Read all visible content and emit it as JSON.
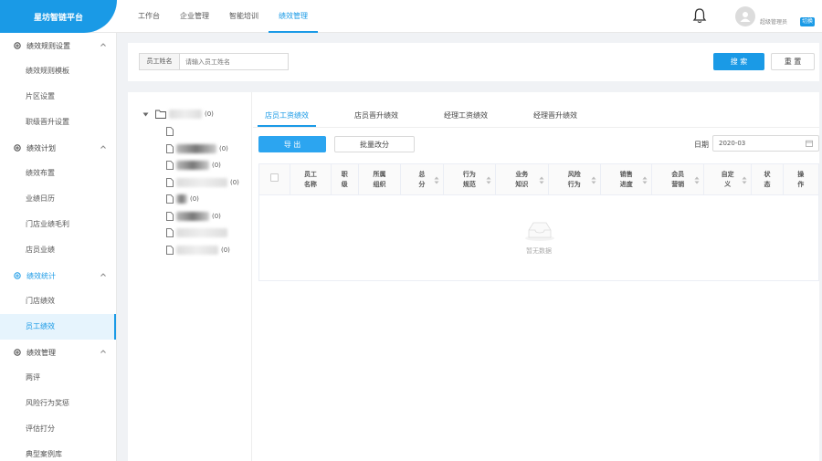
{
  "app": {
    "title": "星坊智链平台"
  },
  "nav": {
    "items": [
      "工作台",
      "企业管理",
      "智能培训",
      "绩效管理"
    ],
    "active_index": 3
  },
  "user": {
    "name": "超级管理员",
    "switch_label": "切换"
  },
  "sidebar": {
    "groups": [
      {
        "label": "绩效规则设置",
        "items": [
          "绩效规则模板",
          "片区设置",
          "职级晋升设置"
        ]
      },
      {
        "label": "绩效计划",
        "items": [
          "绩效布置",
          "业绩日历",
          "门店业绩毛利",
          "店员业绩"
        ]
      },
      {
        "label": "绩效统计",
        "items": [
          "门店绩效",
          "员工绩效"
        ],
        "active": true
      },
      {
        "label": "绩效管理",
        "items": [
          "两评",
          "风险行为奖惩",
          "评估打分",
          "典型案例库"
        ]
      }
    ],
    "active_item": "员工绩效"
  },
  "search": {
    "label": "员工姓名",
    "placeholder": "请输入员工姓名",
    "search_button": "搜 索",
    "reset_button": "重 置"
  },
  "tree": {
    "root_count": "(0)",
    "children_counts": [
      "",
      "(0)",
      "(0)",
      "(0)",
      "(0)",
      "(0)",
      "",
      "(0)"
    ]
  },
  "tabs": [
    "店员工资绩效",
    "店员晋升绩效",
    "经理工资绩效",
    "经理晋升绩效"
  ],
  "active_tab": 0,
  "toolbar": {
    "export_button": "导 出",
    "batch_button": "批量改分",
    "date_label": "日期",
    "date_value": "2020-03"
  },
  "table": {
    "columns": [
      {
        "label": "",
        "width": 34
      },
      {
        "label": "员工\n名称",
        "width": 44
      },
      {
        "label": "职\n级",
        "width": 30
      },
      {
        "label": "所属\n组织",
        "width": 46
      },
      {
        "label": "总\n分",
        "width": 46,
        "sort": true
      },
      {
        "label": "行为\n规范",
        "width": 57,
        "sort": true
      },
      {
        "label": "业务\n知识",
        "width": 57,
        "sort": true
      },
      {
        "label": "风险\n行为",
        "width": 57,
        "sort": true
      },
      {
        "label": "销售\n进度",
        "width": 56,
        "sort": true
      },
      {
        "label": "会员\n营销",
        "width": 56,
        "sort": true
      },
      {
        "label": "自定\n义",
        "width": 52,
        "sort": true
      },
      {
        "label": "状\n态",
        "width": 34
      },
      {
        "label": "操\n作",
        "width": 39
      }
    ],
    "empty_text": "暂无数据"
  },
  "colors": {
    "accent": "#1a9ae6"
  }
}
